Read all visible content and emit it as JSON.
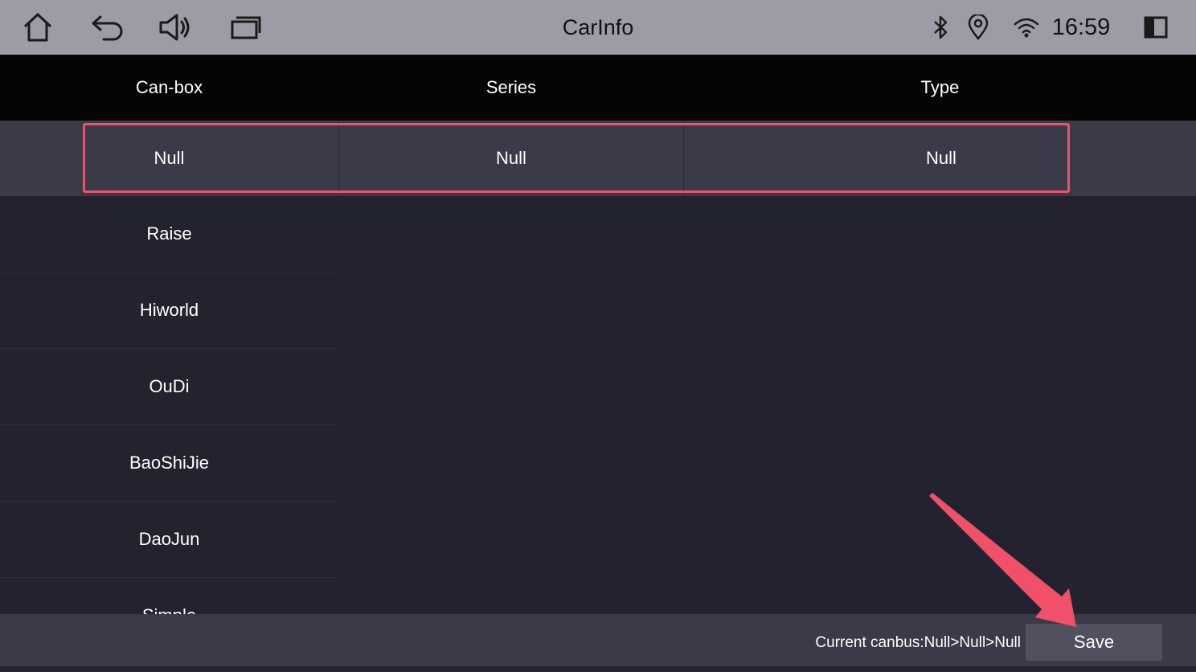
{
  "statusbar": {
    "title": "CarInfo",
    "time": "16:59",
    "icons": [
      "home-icon",
      "back-icon",
      "volume-icon",
      "recent-apps-icon",
      "bluetooth-icon",
      "location-icon",
      "wifi-icon",
      "split-screen-icon"
    ]
  },
  "header": {
    "canbox": "Can-box",
    "series": "Series",
    "type": "Type"
  },
  "selected": {
    "canbox": "Null",
    "series": "Null",
    "type": "Null"
  },
  "canbox_list": [
    "Raise",
    "Hiworld",
    "OuDi",
    "BaoShiJie",
    "DaoJun",
    "Simple"
  ],
  "footer": {
    "current": "Current canbus:Null>Null>Null",
    "save_label": "Save"
  },
  "colors": {
    "highlight": "#f0506a",
    "statusbar": "#9c9ca6",
    "header": "#050505"
  }
}
